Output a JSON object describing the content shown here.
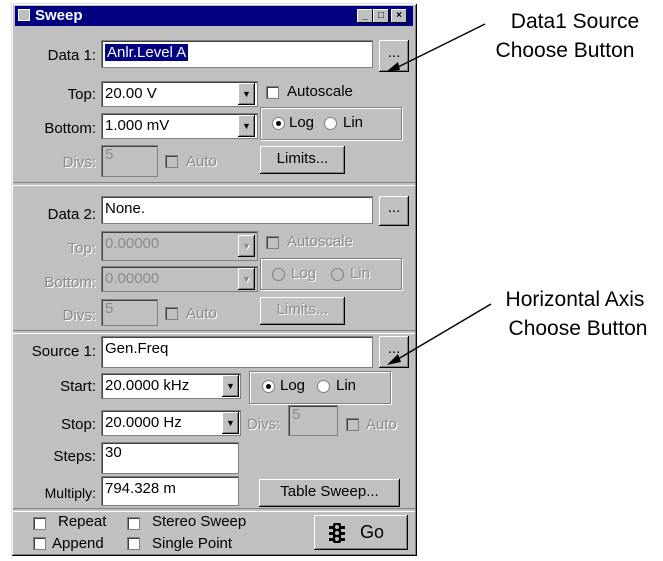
{
  "window": {
    "title": "Sweep",
    "min": "_",
    "max": "□",
    "close": "×"
  },
  "data1": {
    "label": "Data 1:",
    "value": "Anlr.Level A",
    "browse": "...",
    "top_label": "Top:",
    "top_value": "20.00   V",
    "bottom_label": "Bottom:",
    "bottom_value": "1.000  mV",
    "autoscale": "Autoscale",
    "log": "Log",
    "lin": "Lin",
    "divs_label": "Divs:",
    "divs_value": "5",
    "auto": "Auto",
    "limits": "Limits..."
  },
  "data2": {
    "label": "Data 2:",
    "value": "None.",
    "browse": "...",
    "top_label": "Top:",
    "top_value": "0.00000",
    "bottom_label": "Bottom:",
    "bottom_value": "0.00000",
    "autoscale": "Autoscale",
    "log": "Log",
    "lin": "Lin",
    "divs_label": "Divs:",
    "divs_value": "5",
    "auto": "Auto",
    "limits": "Limits..."
  },
  "source1": {
    "label": "Source 1:",
    "value": "Gen.Freq",
    "browse": "...",
    "start_label": "Start:",
    "start_value": "20.0000 kHz",
    "stop_label": "Stop:",
    "stop_value": "20.0000  Hz",
    "log": "Log",
    "lin": "Lin",
    "divs_label": "Divs:",
    "divs_value": "5",
    "auto": "Auto",
    "steps_label": "Steps:",
    "steps_value": "30",
    "multiply_label": "Multiply:",
    "multiply_value": "794.328 m",
    "table_sweep": "Table Sweep..."
  },
  "options": {
    "repeat": "Repeat",
    "append": "Append",
    "stereo": "Stereo Sweep",
    "single": "Single Point",
    "go": "Go"
  },
  "annotations": {
    "a1_line1": "Data1 Source",
    "a1_line2": "Choose Button",
    "a2_line1": "Horizontal Axis",
    "a2_line2": "Choose Button"
  }
}
